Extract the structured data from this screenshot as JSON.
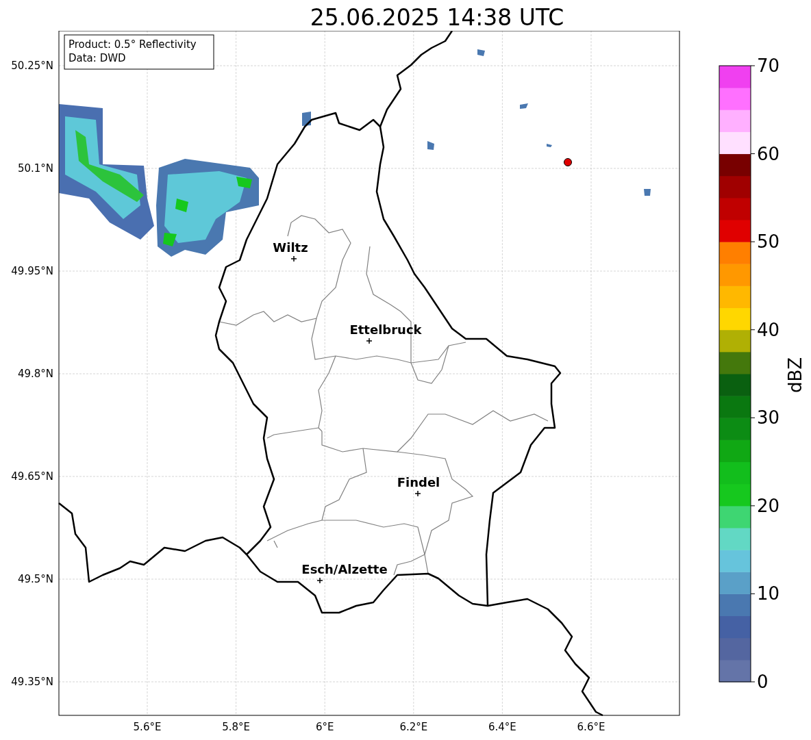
{
  "title": "25.06.2025 14:38 UTC",
  "info_box": [
    "Product: 0.5° Reflectivity",
    "Data: DWD"
  ],
  "map": {
    "lat_ticks": [
      "50.25°N",
      "50.1°N",
      "49.95°N",
      "49.8°N",
      "49.65°N",
      "49.5°N",
      "49.35°N"
    ],
    "lon_ticks": [
      "5.6°E",
      "5.8°E",
      "6°E",
      "6.2°E",
      "6.4°E",
      "6.6°E"
    ],
    "places": [
      {
        "name": "Wiltz"
      },
      {
        "name": "Ettelbruck"
      },
      {
        "name": "Findel"
      },
      {
        "name": "Esch/Alzette"
      }
    ]
  },
  "colorbar": {
    "label": "dBZ",
    "ticks": [
      "70",
      "60",
      "50",
      "40",
      "30",
      "20",
      "10",
      "0"
    ],
    "bins": [
      {
        "color": "#6474a8"
      },
      {
        "color": "#5466a0"
      },
      {
        "color": "#4561a4"
      },
      {
        "color": "#4a78b0"
      },
      {
        "color": "#5aa0c8"
      },
      {
        "color": "#66c4dc"
      },
      {
        "color": "#62d8c4"
      },
      {
        "color": "#3ed672"
      },
      {
        "color": "#16c81e"
      },
      {
        "color": "#12be1c"
      },
      {
        "color": "#10a814"
      },
      {
        "color": "#0c8c14"
      },
      {
        "color": "#0a7810"
      },
      {
        "color": "#0a6010"
      },
      {
        "color": "#44780c"
      },
      {
        "color": "#b0b004"
      },
      {
        "color": "#ffd700"
      },
      {
        "color": "#ffb800"
      },
      {
        "color": "#ff9800"
      },
      {
        "color": "#ff7f00"
      },
      {
        "color": "#e00000"
      },
      {
        "color": "#c00000"
      },
      {
        "color": "#a00000"
      },
      {
        "color": "#780000"
      },
      {
        "color": "#ffe0ff"
      },
      {
        "color": "#ffb0ff"
      },
      {
        "color": "#ff70ff"
      },
      {
        "color": "#f040f0"
      }
    ]
  }
}
